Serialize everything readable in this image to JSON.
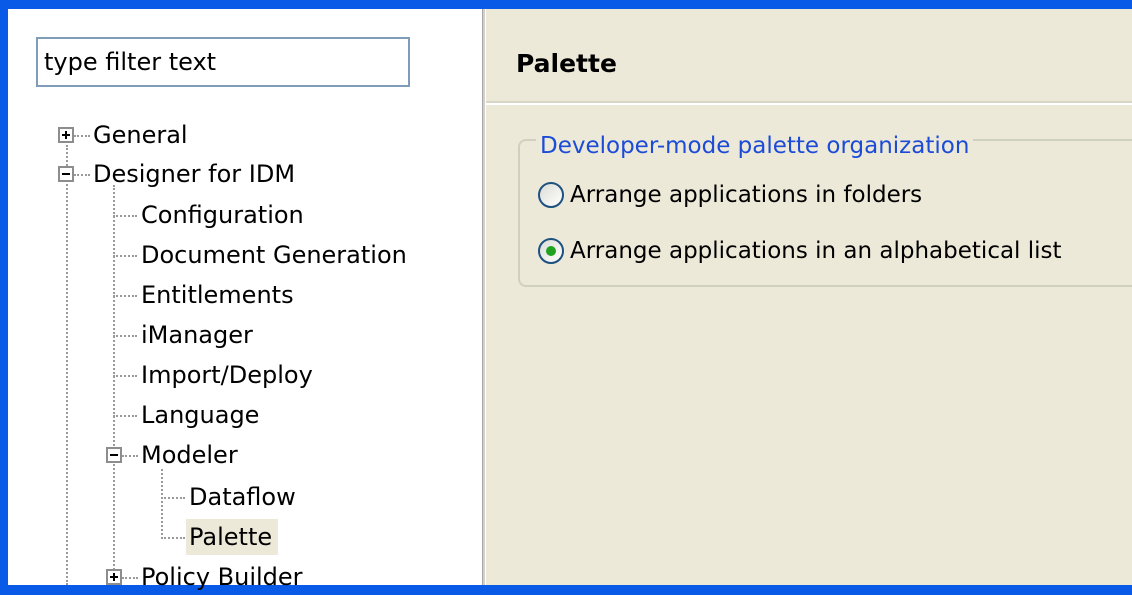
{
  "filter": {
    "placeholder": "type filter text"
  },
  "tree": {
    "general": "General",
    "designer": "Designer for IDM",
    "configuration": "Configuration",
    "document_generation": "Document Generation",
    "entitlements": "Entitlements",
    "imanager": "iManager",
    "import_deploy": "Import/Deploy",
    "language": "Language",
    "modeler": "Modeler",
    "dataflow": "Dataflow",
    "palette": "Palette",
    "policy_builder": "Policy Builder",
    "selected": "Palette"
  },
  "page": {
    "title": "Palette",
    "group_label": "Developer-mode palette organization",
    "options": [
      {
        "label": "Arrange applications in folders",
        "checked": false
      },
      {
        "label": "Arrange applications in an alphabetical list",
        "checked": true
      }
    ]
  },
  "colors": {
    "accent_blue": "#0a5ae8",
    "legend_blue": "#1c4bd8",
    "panel_bg": "#ece9d8"
  }
}
